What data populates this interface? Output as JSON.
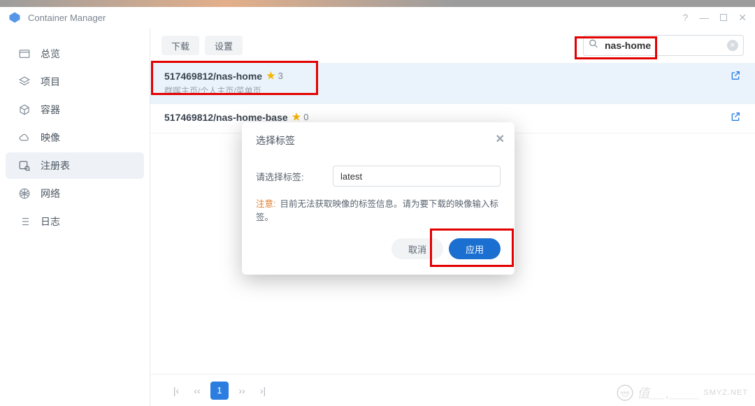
{
  "app": {
    "title": "Container Manager"
  },
  "sidebar": {
    "items": [
      {
        "label": "总览"
      },
      {
        "label": "项目"
      },
      {
        "label": "容器"
      },
      {
        "label": "映像"
      },
      {
        "label": "注册表"
      },
      {
        "label": "网络"
      },
      {
        "label": "日志"
      }
    ],
    "active_index": 4
  },
  "toolbar": {
    "download": "下载",
    "settings": "设置"
  },
  "search": {
    "value": "nas-home"
  },
  "results": [
    {
      "name": "517469812/nas-home",
      "stars": "3",
      "desc": "群晖主页/个人主页/菜单页",
      "selected": true
    },
    {
      "name": "517469812/nas-home-base",
      "stars": "0",
      "desc": "",
      "selected": false
    }
  ],
  "pager": {
    "current": "1"
  },
  "modal": {
    "title": "选择标签",
    "label": "请选择标签:",
    "value": "latest",
    "note_prefix": "注意:",
    "note_text": "目前无法获取映像的标签信息。请为要下载的映像输入标签。",
    "cancel": "取消",
    "apply": "应用"
  },
  "watermark": {
    "main": "值__,____",
    "sub": "SMYZ.NET"
  }
}
